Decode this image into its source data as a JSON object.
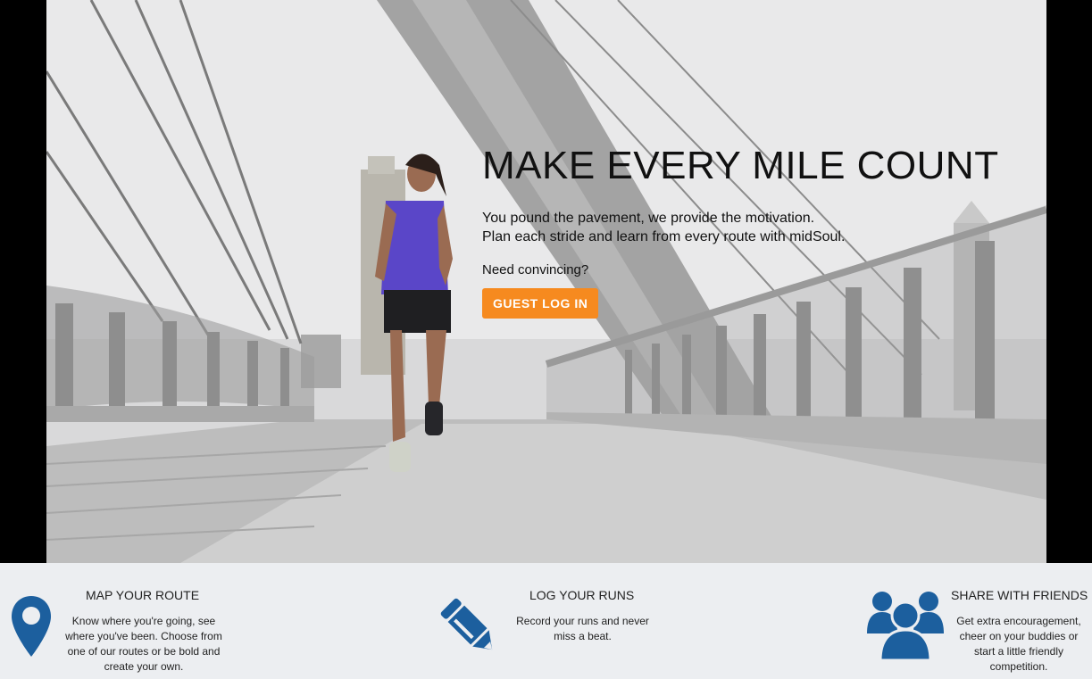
{
  "hero": {
    "title": "MAKE EVERY MILE COUNT",
    "subtitle_line1": "You pound the pavement, we provide the motivation.",
    "subtitle_line2": "Plan each stride and learn from every route with midSoul.",
    "cta_lead": "Need convincing?",
    "cta_button": "GUEST LOG IN"
  },
  "features": [
    {
      "title": "MAP YOUR ROUTE",
      "text": "Know where you're going, see where you've been. Choose from one of our routes or be bold and create your own.",
      "icon": "map-pin-icon"
    },
    {
      "title": "LOG YOUR RUNS",
      "text": "Record your runs and never miss a beat.",
      "icon": "pencil-icon"
    },
    {
      "title": "SHARE WITH FRIENDS",
      "text": "Get extra encouragement, cheer on your buddies or start a little friendly competition.",
      "icon": "group-icon"
    }
  ],
  "colors": {
    "accent": "#f68a1f",
    "icon_blue": "#1c5f9e",
    "feature_bg": "#eceef1"
  }
}
